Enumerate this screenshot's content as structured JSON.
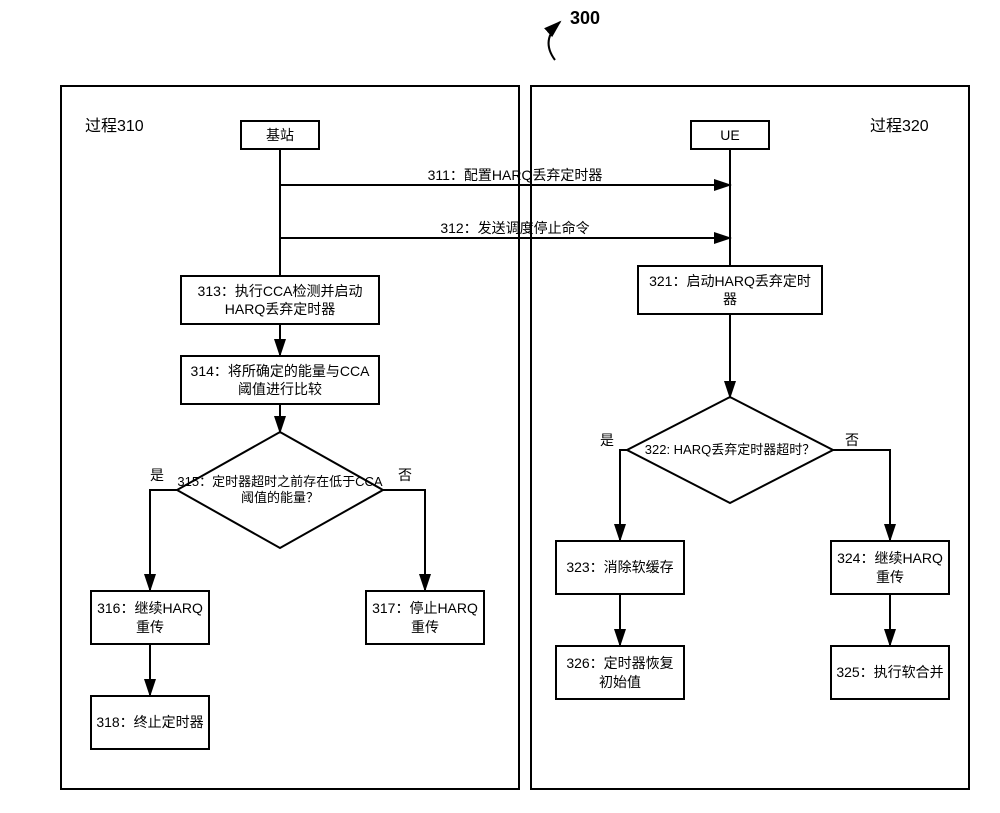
{
  "title_number": "300",
  "left_panel_label": "过程310",
  "right_panel_label": "过程320",
  "base_station_label": "基站",
  "ue_label": "UE",
  "msg311": "311：配置HARQ丢弃定时器",
  "msg312": "312：发送调度停止命令",
  "box313": "313：执行CCA检测并启动HARQ丢弃定时器",
  "box314": "314：将所确定的能量与CCA阈值进行比较",
  "dec315": "315：定时器超时之前存在低于CCA阈值的能量？",
  "box316": "316：继续HARQ重传",
  "box317": "317：停止HARQ重传",
  "box318": "318：终止定时器",
  "box321": "321：启动HARQ丢弃定时器",
  "dec322": "322: HARQ丢弃定时器超时？",
  "box323": "323：消除软缓存",
  "box324": "324：继续HARQ重传",
  "box325": "325：执行软合并",
  "box326": "326：定时器恢复初始值",
  "yes": "是",
  "no": "否",
  "chart_data": {
    "type": "flowchart",
    "title": "300",
    "swimlanes": [
      {
        "id": "process_310",
        "label": "过程310",
        "actor": "基站"
      },
      {
        "id": "process_320",
        "label": "过程320",
        "actor": "UE"
      }
    ],
    "nodes": [
      {
        "id": "bs",
        "lane": "process_310",
        "type": "actor",
        "text": "基站"
      },
      {
        "id": "ue",
        "lane": "process_320",
        "type": "actor",
        "text": "UE"
      },
      {
        "id": "313",
        "lane": "process_310",
        "type": "process",
        "text": "313：执行CCA检测并启动HARQ丢弃定时器"
      },
      {
        "id": "314",
        "lane": "process_310",
        "type": "process",
        "text": "314：将所确定的能量与CCA阈值进行比较"
      },
      {
        "id": "315",
        "lane": "process_310",
        "type": "decision",
        "text": "315：定时器超时之前存在低于CCA阈值的能量？"
      },
      {
        "id": "316",
        "lane": "process_310",
        "type": "process",
        "text": "316：继续HARQ重传"
      },
      {
        "id": "317",
        "lane": "process_310",
        "type": "process",
        "text": "317：停止HARQ重传"
      },
      {
        "id": "318",
        "lane": "process_310",
        "type": "process",
        "text": "318：终止定时器"
      },
      {
        "id": "321",
        "lane": "process_320",
        "type": "process",
        "text": "321：启动HARQ丢弃定时器"
      },
      {
        "id": "322",
        "lane": "process_320",
        "type": "decision",
        "text": "322: HARQ丢弃定时器超时？"
      },
      {
        "id": "323",
        "lane": "process_320",
        "type": "process",
        "text": "323：消除软缓存"
      },
      {
        "id": "324",
        "lane": "process_320",
        "type": "process",
        "text": "324：继续HARQ重传"
      },
      {
        "id": "325",
        "lane": "process_320",
        "type": "process",
        "text": "325：执行软合并"
      },
      {
        "id": "326",
        "lane": "process_320",
        "type": "process",
        "text": "326：定时器恢复初始值"
      }
    ],
    "messages": [
      {
        "id": "311",
        "from": "bs",
        "to": "ue",
        "text": "311：配置HARQ丢弃定时器"
      },
      {
        "id": "312",
        "from": "bs",
        "to": "ue",
        "text": "312：发送调度停止命令"
      }
    ],
    "edges": [
      {
        "from": "312",
        "to": "313"
      },
      {
        "from": "313",
        "to": "314"
      },
      {
        "from": "314",
        "to": "315"
      },
      {
        "from": "315",
        "to": "316",
        "label": "是"
      },
      {
        "from": "315",
        "to": "317",
        "label": "否"
      },
      {
        "from": "316",
        "to": "318"
      },
      {
        "from": "312",
        "to": "321"
      },
      {
        "from": "321",
        "to": "322"
      },
      {
        "from": "322",
        "to": "323",
        "label": "是"
      },
      {
        "from": "322",
        "to": "324",
        "label": "否"
      },
      {
        "from": "323",
        "to": "326"
      },
      {
        "from": "324",
        "to": "325"
      }
    ]
  }
}
